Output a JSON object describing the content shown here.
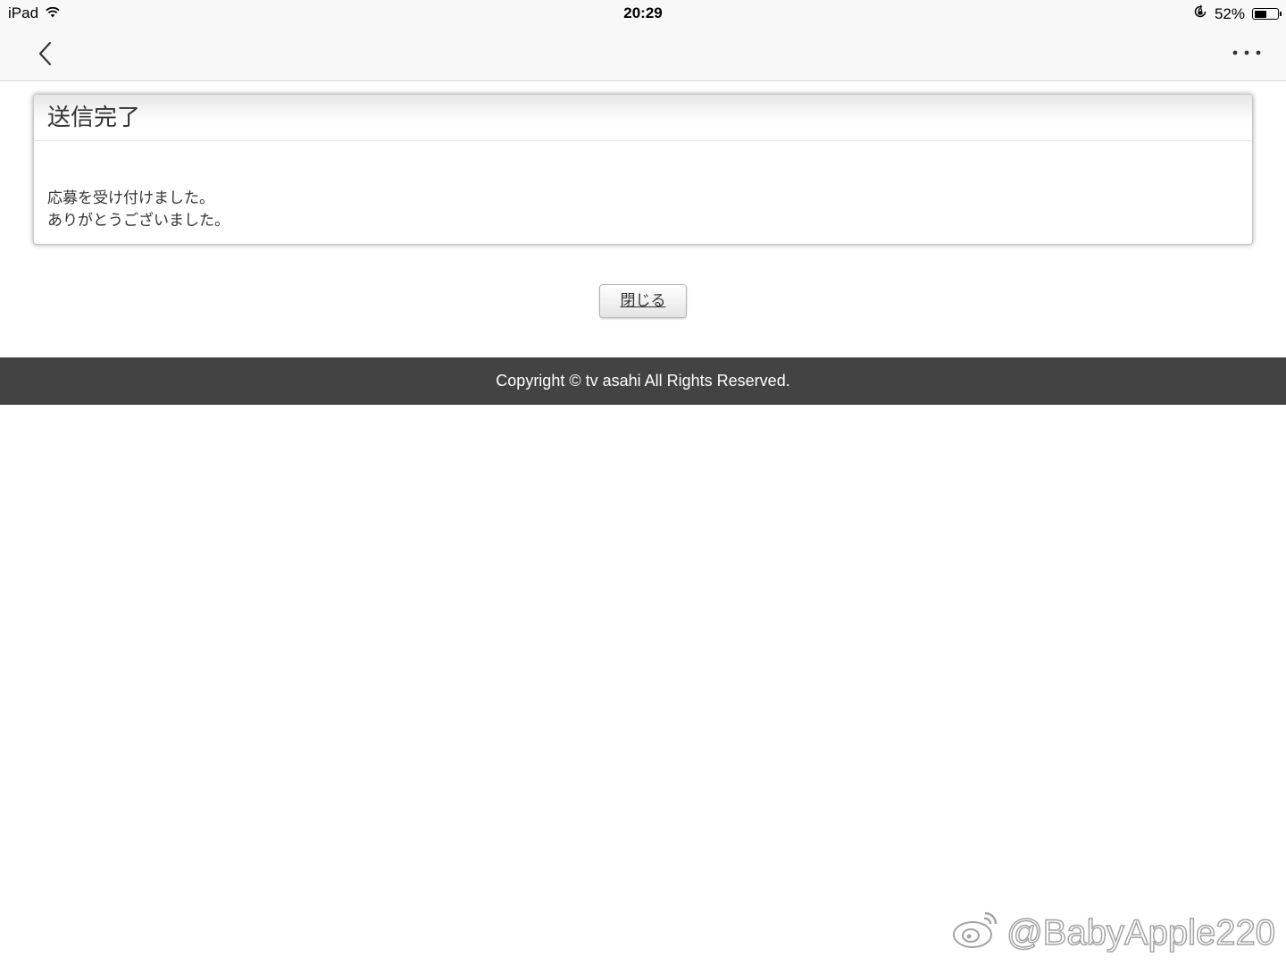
{
  "status_bar": {
    "device": "iPad",
    "time": "20:29",
    "battery_percent": "52%",
    "battery_level": 0.52
  },
  "nav": {
    "back_icon": "chevron-left-icon",
    "more_icon": "more-horizontal-icon"
  },
  "panel": {
    "title": "送信完了",
    "message_line1": "応募を受け付けました。",
    "message_line2": "ありがとうございました。"
  },
  "actions": {
    "close_label": "閉じる"
  },
  "footer": {
    "copyright": "Copyright © tv asahi All Rights Reserved."
  },
  "watermark": {
    "text": "@BabyApple220"
  },
  "colors": {
    "footer_bg": "#434343",
    "nav_bg": "#f8f8f8"
  }
}
